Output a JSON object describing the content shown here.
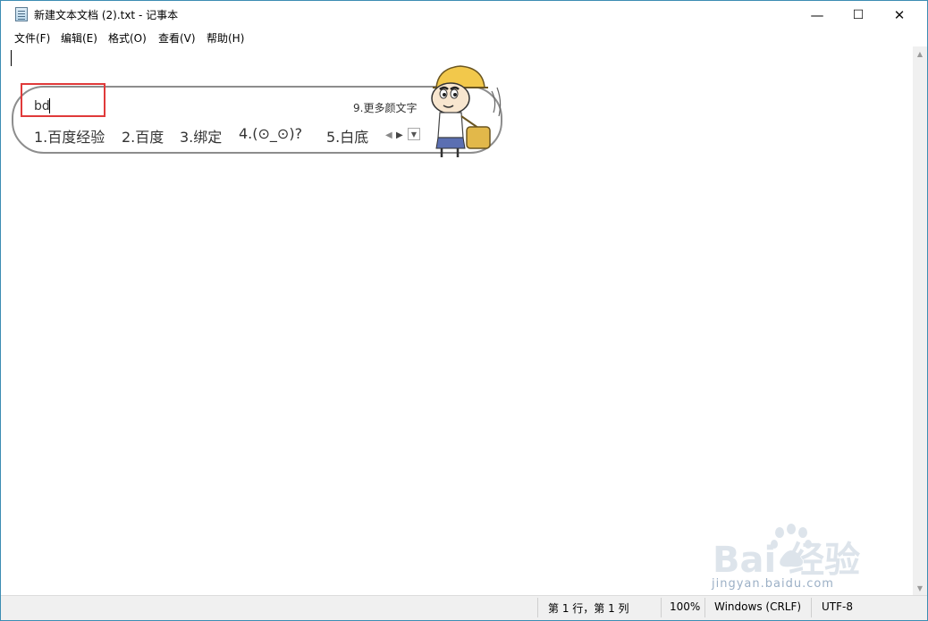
{
  "titlebar": {
    "title": "新建文本文档 (2).txt - 记事本",
    "minimize": "—",
    "maximize": "☐",
    "close": "✕"
  },
  "menu": [
    "文件(F)",
    "编辑(E)",
    "格式(O)",
    "查看(V)",
    "帮助(H)"
  ],
  "ime": {
    "input": "bd",
    "more_label": "9.更多颜文字",
    "candidates": [
      "1.百度经验",
      "2.百度",
      "3.绑定",
      "4.(⊙_⊙)?",
      "5.白底"
    ],
    "nav_prev": "◀",
    "nav_next": "▶",
    "dropdown": "▼"
  },
  "scrollbar": {
    "up": "▲",
    "down": "▼"
  },
  "status": {
    "position": "第 1 行，第 1 列",
    "zoom": "100%",
    "line_ending": "Windows (CRLF)",
    "encoding": "UTF-8"
  },
  "watermark": {
    "logo": "Bai 经验",
    "url": "jingyan.baidu.com"
  },
  "colors": {
    "highlight": "#e03a3a",
    "accent": "#3c8db3"
  }
}
